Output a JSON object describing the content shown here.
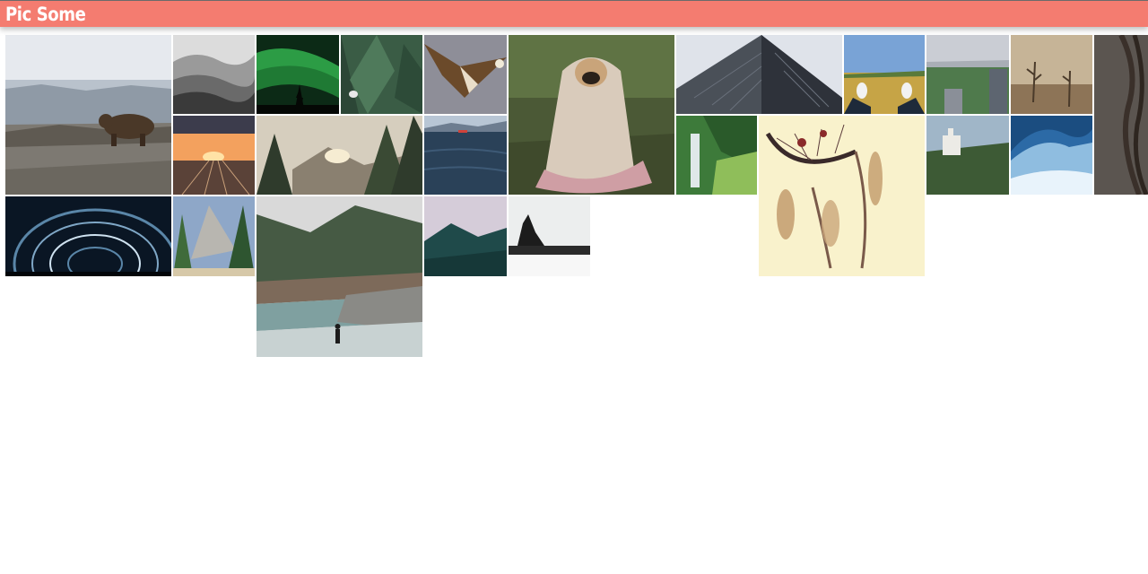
{
  "app": {
    "title": "Pic Some"
  },
  "photos": [
    {
      "id": "bear",
      "subject": "bear-on-rocks",
      "palette": [
        "#e7e9ec",
        "#7a7872",
        "#4a3a2a"
      ]
    },
    {
      "id": "misty-hills",
      "subject": "foggy-hills",
      "palette": [
        "#d9d9d9",
        "#6c6c6c",
        "#2f2f2f"
      ]
    },
    {
      "id": "aurora",
      "subject": "northern-lights",
      "palette": [
        "#0e3d1c",
        "#2fa24a",
        "#0a0f0a"
      ]
    },
    {
      "id": "pine-bird",
      "subject": "bird-in-pine",
      "palette": [
        "#33533f",
        "#5e7e66",
        "#e6e6e6"
      ]
    },
    {
      "id": "eagle",
      "subject": "eagle-flying",
      "palette": [
        "#8f8f9a",
        "#6b4a2a",
        "#e8e0d2"
      ]
    },
    {
      "id": "pug",
      "subject": "pug-in-blanket",
      "palette": [
        "#4c5a35",
        "#d7c7b8",
        "#c79a9e"
      ]
    },
    {
      "id": "skyscraper",
      "subject": "glass-tower",
      "palette": [
        "#e1e4ea",
        "#555b66",
        "#2b2f36"
      ]
    },
    {
      "id": "feet-field",
      "subject": "feet-on-field",
      "palette": [
        "#7aa4d8",
        "#c8a548",
        "#1f2a3a"
      ]
    },
    {
      "id": "city-park",
      "subject": "city-park",
      "palette": [
        "#c9ccd3",
        "#4d7a4b",
        "#6b7380"
      ]
    },
    {
      "id": "dead-trees",
      "subject": "misty-dead-trees",
      "palette": [
        "#c7b598",
        "#8f7658",
        "#4a3a2a"
      ]
    },
    {
      "id": "hair",
      "subject": "hair-closeup",
      "palette": [
        "#5a5450",
        "#3b332e",
        "#7a6f66"
      ]
    },
    {
      "id": "train-sunset",
      "subject": "rail-sunset",
      "palette": [
        "#3a3a4a",
        "#f3a15d",
        "#6a4a3a"
      ]
    },
    {
      "id": "forest-sun",
      "subject": "forest-sunrise",
      "palette": [
        "#d8d0c0",
        "#3d4b3a",
        "#f0e6cf"
      ]
    },
    {
      "id": "lake-boat",
      "subject": "lake-boat",
      "palette": [
        "#b9c7d6",
        "#2b4258",
        "#d0423a"
      ]
    },
    {
      "id": "waterfall",
      "subject": "waterfall",
      "palette": [
        "#3e7a3a",
        "#8fbf5a",
        "#dfe8e8"
      ]
    },
    {
      "id": "dreamcatcher",
      "subject": "dreamcatcher",
      "palette": [
        "#f5efc0",
        "#7a5a4a",
        "#8a2a2a"
      ]
    },
    {
      "id": "castle",
      "subject": "castle-in-forest",
      "palette": [
        "#9fb6c8",
        "#3d5a35",
        "#ecebe6"
      ]
    },
    {
      "id": "wave",
      "subject": "ocean-wave",
      "palette": [
        "#1b4d80",
        "#8fbde0",
        "#e8f3fb"
      ]
    },
    {
      "id": "star-trails",
      "subject": "star-trails",
      "palette": [
        "#0a1624",
        "#5a86a8",
        "#cfe2f0"
      ]
    },
    {
      "id": "yosemite",
      "subject": "yosemite-valley",
      "palette": [
        "#8ea7c8",
        "#3f6b3a",
        "#d6c8a8"
      ]
    },
    {
      "id": "river-hiker",
      "subject": "river-hiker",
      "palette": [
        "#d8d8d8",
        "#465a44",
        "#7fa0a0"
      ]
    },
    {
      "id": "misty-peak",
      "subject": "misty-mountain",
      "palette": [
        "#d4cbd8",
        "#1f4a4a",
        "#e2dbe6"
      ]
    },
    {
      "id": "sea-stack",
      "subject": "sea-stack",
      "palette": [
        "#eceeee",
        "#1c1c1c",
        "#f7f7f7"
      ]
    }
  ]
}
